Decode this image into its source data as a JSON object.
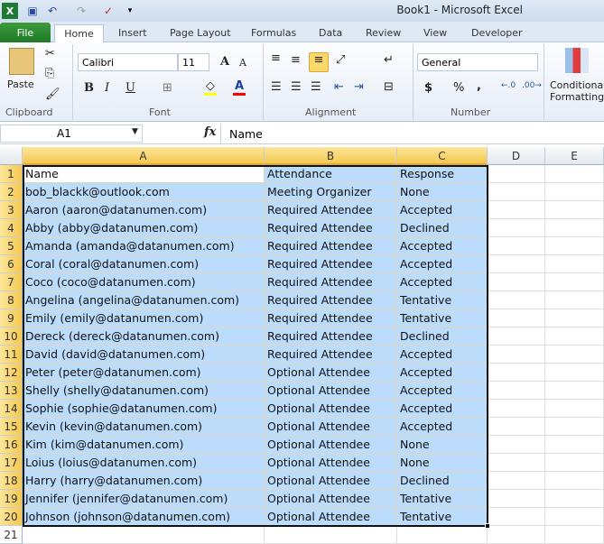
{
  "window": {
    "title": "Book1  -  Microsoft Excel"
  },
  "quick_access": [
    "excel-icon",
    "save-icon",
    "undo-icon",
    "redo-icon",
    "spellcheck-icon",
    "customize-icon"
  ],
  "tabs": [
    "File",
    "Home",
    "Insert",
    "Page Layout",
    "Formulas",
    "Data",
    "Review",
    "View",
    "Developer"
  ],
  "ribbon": {
    "clipboard": {
      "label": "Clipboard",
      "paste": "Paste"
    },
    "font": {
      "label": "Font",
      "name": "Calibri",
      "size": "11",
      "bold": "B",
      "italic": "I",
      "underline": "U",
      "grow": "A",
      "shrink": "A",
      "font_color": "A",
      "highlight_color": "#ffff00",
      "text_color": "#ff0000"
    },
    "alignment": {
      "label": "Alignment"
    },
    "number": {
      "label": "Number",
      "format": "General",
      "currency": "$",
      "percent": "%",
      "comma": ","
    },
    "styles": {
      "conditional": "Conditional",
      "formatting": "Formatting"
    }
  },
  "formula_bar": {
    "name_box": "A1",
    "fx": "fx",
    "value": "Name"
  },
  "columns": [
    "A",
    "B",
    "C",
    "D",
    "E"
  ],
  "rows": [
    [
      "Name",
      "Attendance",
      "Response"
    ],
    [
      "bob_blackk@outlook.com",
      "Meeting Organizer",
      "None"
    ],
    [
      "Aaron (aaron@datanumen.com)",
      "Required Attendee",
      "Accepted"
    ],
    [
      "Abby (abby@datanumen.com)",
      "Required Attendee",
      "Declined"
    ],
    [
      "Amanda (amanda@datanumen.com)",
      "Required Attendee",
      "Accepted"
    ],
    [
      "Coral (coral@datanumen.com)",
      "Required Attendee",
      "Accepted"
    ],
    [
      "Coco (coco@datanumen.com)",
      "Required Attendee",
      "Accepted"
    ],
    [
      "Angelina (angelina@datanumen.com)",
      "Required Attendee",
      "Tentative"
    ],
    [
      "Emily (emily@datanumen.com)",
      "Required Attendee",
      "Tentative"
    ],
    [
      "Dereck (dereck@datanumen.com)",
      "Required Attendee",
      "Declined"
    ],
    [
      "David (david@datanumen.com)",
      "Required Attendee",
      "Accepted"
    ],
    [
      "Peter (peter@datanumen.com)",
      "Optional Attendee",
      "Accepted"
    ],
    [
      "Shelly (shelly@datanumen.com)",
      "Optional Attendee",
      "Accepted"
    ],
    [
      "Sophie (sophie@datanumen.com)",
      "Optional Attendee",
      "Accepted"
    ],
    [
      "Kevin (kevin@datanumen.com)",
      "Optional Attendee",
      "Accepted"
    ],
    [
      "Kim (kim@datanumen.com)",
      "Optional Attendee",
      "None"
    ],
    [
      "Loius (loius@datanumen.com)",
      "Optional Attendee",
      "None"
    ],
    [
      "Harry (harry@datanumen.com)",
      "Optional Attendee",
      "Declined"
    ],
    [
      "Jennifer (jennifer@datanumen.com)",
      "Optional Attendee",
      "Tentative"
    ],
    [
      "Johnson (johnson@datanumen.com)",
      "Optional Attendee",
      "Tentative"
    ]
  ],
  "selection": {
    "range": "A1:C20",
    "active": "A1",
    "fill": "#bcdcfc"
  }
}
